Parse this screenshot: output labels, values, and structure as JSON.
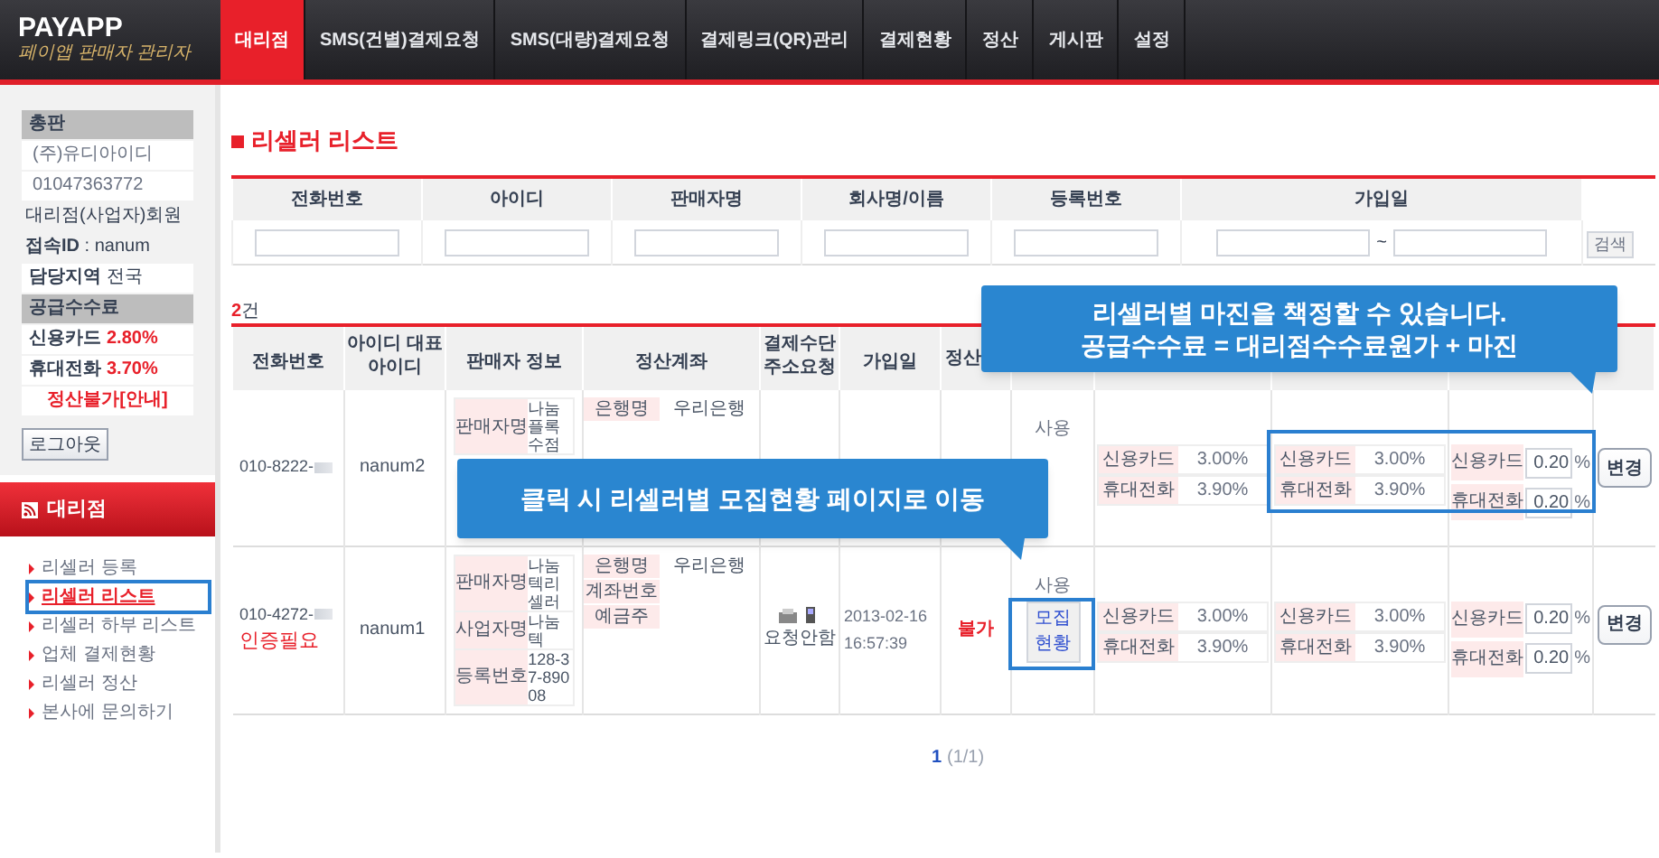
{
  "logo": {
    "name": "PAYAPP",
    "tagline": "페이앱 판매자 관리자"
  },
  "nav": [
    {
      "label": "대리점",
      "selected": true
    },
    {
      "label": "SMS(건별)결제요청",
      "selected": false
    },
    {
      "label": "SMS(대량)결제요청",
      "selected": false
    },
    {
      "label": "결제링크(QR)관리",
      "selected": false
    },
    {
      "label": "결제현황",
      "selected": false
    },
    {
      "label": "정산",
      "selected": false
    },
    {
      "label": "게시판",
      "selected": false
    },
    {
      "label": "설정",
      "selected": false
    }
  ],
  "sidebar": {
    "account": {
      "header": "총판",
      "company": "(주)유디아이디",
      "phone": "01047363772",
      "bullets": [
        "대리점(사업자)회원",
        "**접속ID** : nanum"
      ],
      "region": "**담당지역** 전국"
    },
    "fees": {
      "header": "공급수수료",
      "items": [
        {
          "label": "신용카드",
          "value": "2.80",
          "unit": "%"
        },
        {
          "label": "휴대전화",
          "value": "3.70",
          "unit": "%"
        }
      ],
      "notice": "정산불가[안내]"
    },
    "logout": "로그아웃",
    "menu": {
      "title": "대리점",
      "items": [
        {
          "label": "리셀러 등록",
          "selected": false
        },
        {
          "label": "리셀러 리스트",
          "selected": true
        },
        {
          "label": "리셀러 하부 리스트",
          "selected": false
        },
        {
          "label": "업체 결제현황",
          "selected": false
        },
        {
          "label": "리셀러 정산",
          "selected": false
        },
        {
          "label": "본사에 문의하기",
          "selected": false
        }
      ]
    }
  },
  "page_title": "리셀러 리스트",
  "search": {
    "columns": [
      {
        "label": "전화번호",
        "kind": "text"
      },
      {
        "label": "아이디",
        "kind": "text"
      },
      {
        "label": "판매자명",
        "kind": "text"
      },
      {
        "label": "회사명/이름",
        "kind": "text"
      },
      {
        "label": "등록번호",
        "kind": "text"
      },
      {
        "label": "가입일",
        "kind": "range"
      }
    ],
    "range_separator": "~",
    "button": "검색"
  },
  "count": {
    "number": "2",
    "unit": "건"
  },
  "table": {
    "columns": [
      "전화번호",
      "아이디 대표아이디",
      "판매자 정보",
      "정산계좌",
      "결제수단 주소요청",
      "가입일",
      "정산"
    ],
    "rows": [
      {
        "phone": "010-8222-",
        "id": "nanum2",
        "seller": [
          {
            "label": "판매자명",
            "value": "나눔플록수점"
          }
        ],
        "account": [
          {
            "label": "은행명",
            "value": "우리은행"
          }
        ],
        "usage": "사용",
        "fee_groups": [
          {
            "kind": "rate",
            "items": [
              {
                "label": "신용카드",
                "value": "3.00%"
              },
              {
                "label": "휴대전화",
                "value": "3.90%"
              }
            ]
          },
          {
            "kind": "rate",
            "items": [
              {
                "label": "신용카드",
                "value": "3.00%"
              },
              {
                "label": "휴대전화",
                "value": "3.90%"
              }
            ]
          },
          {
            "kind": "margin",
            "items": [
              {
                "label": "신용카드",
                "value": "0.20",
                "unit": "%"
              },
              {
                "label": "휴대전화",
                "value": "0.20",
                "unit": "%"
              }
            ]
          }
        ],
        "action": "변경"
      },
      {
        "phone": "010-4272-",
        "note": "인증필요",
        "id": "nanum1",
        "seller": [
          {
            "label": "판매자명",
            "value": "나눔텍리셀러"
          },
          {
            "label": "사업자명",
            "value": "나눔텍"
          },
          {
            "label": "등록번호",
            "value": "128-37-89008"
          }
        ],
        "account": [
          {
            "label": "은행명",
            "value": "우리은행"
          },
          {
            "label": "계좌번호"
          },
          {
            "label": "예금주"
          }
        ],
        "payment_method": "요청안함",
        "join_date": "2013-02-16 16:57:39",
        "settlement": "불가",
        "usage": "사용",
        "recruit_button": "모집현황",
        "fee_groups": [
          {
            "kind": "rate",
            "items": [
              {
                "label": "신용카드",
                "value": "3.00%"
              },
              {
                "label": "휴대전화",
                "value": "3.90%"
              }
            ]
          },
          {
            "kind": "rate",
            "items": [
              {
                "label": "신용카드",
                "value": "3.00%"
              },
              {
                "label": "휴대전화",
                "value": "3.90%"
              }
            ]
          },
          {
            "kind": "margin",
            "items": [
              {
                "label": "신용카드",
                "value": "0.20",
                "unit": "%"
              },
              {
                "label": "휴대전화",
                "value": "0.20",
                "unit": "%"
              }
            ]
          }
        ],
        "action": "변경"
      }
    ]
  },
  "pagination": {
    "current": "1",
    "total": "(1/1)"
  },
  "callouts": [
    {
      "lines": [
        "리셀러별 마진을 책정할 수 있습니다.",
        "공급수수료 = 대리점수수료원가 + 마진"
      ]
    },
    {
      "lines": [
        "클릭 시 리셀러별 모집현황 페이지로 이동"
      ]
    }
  ]
}
